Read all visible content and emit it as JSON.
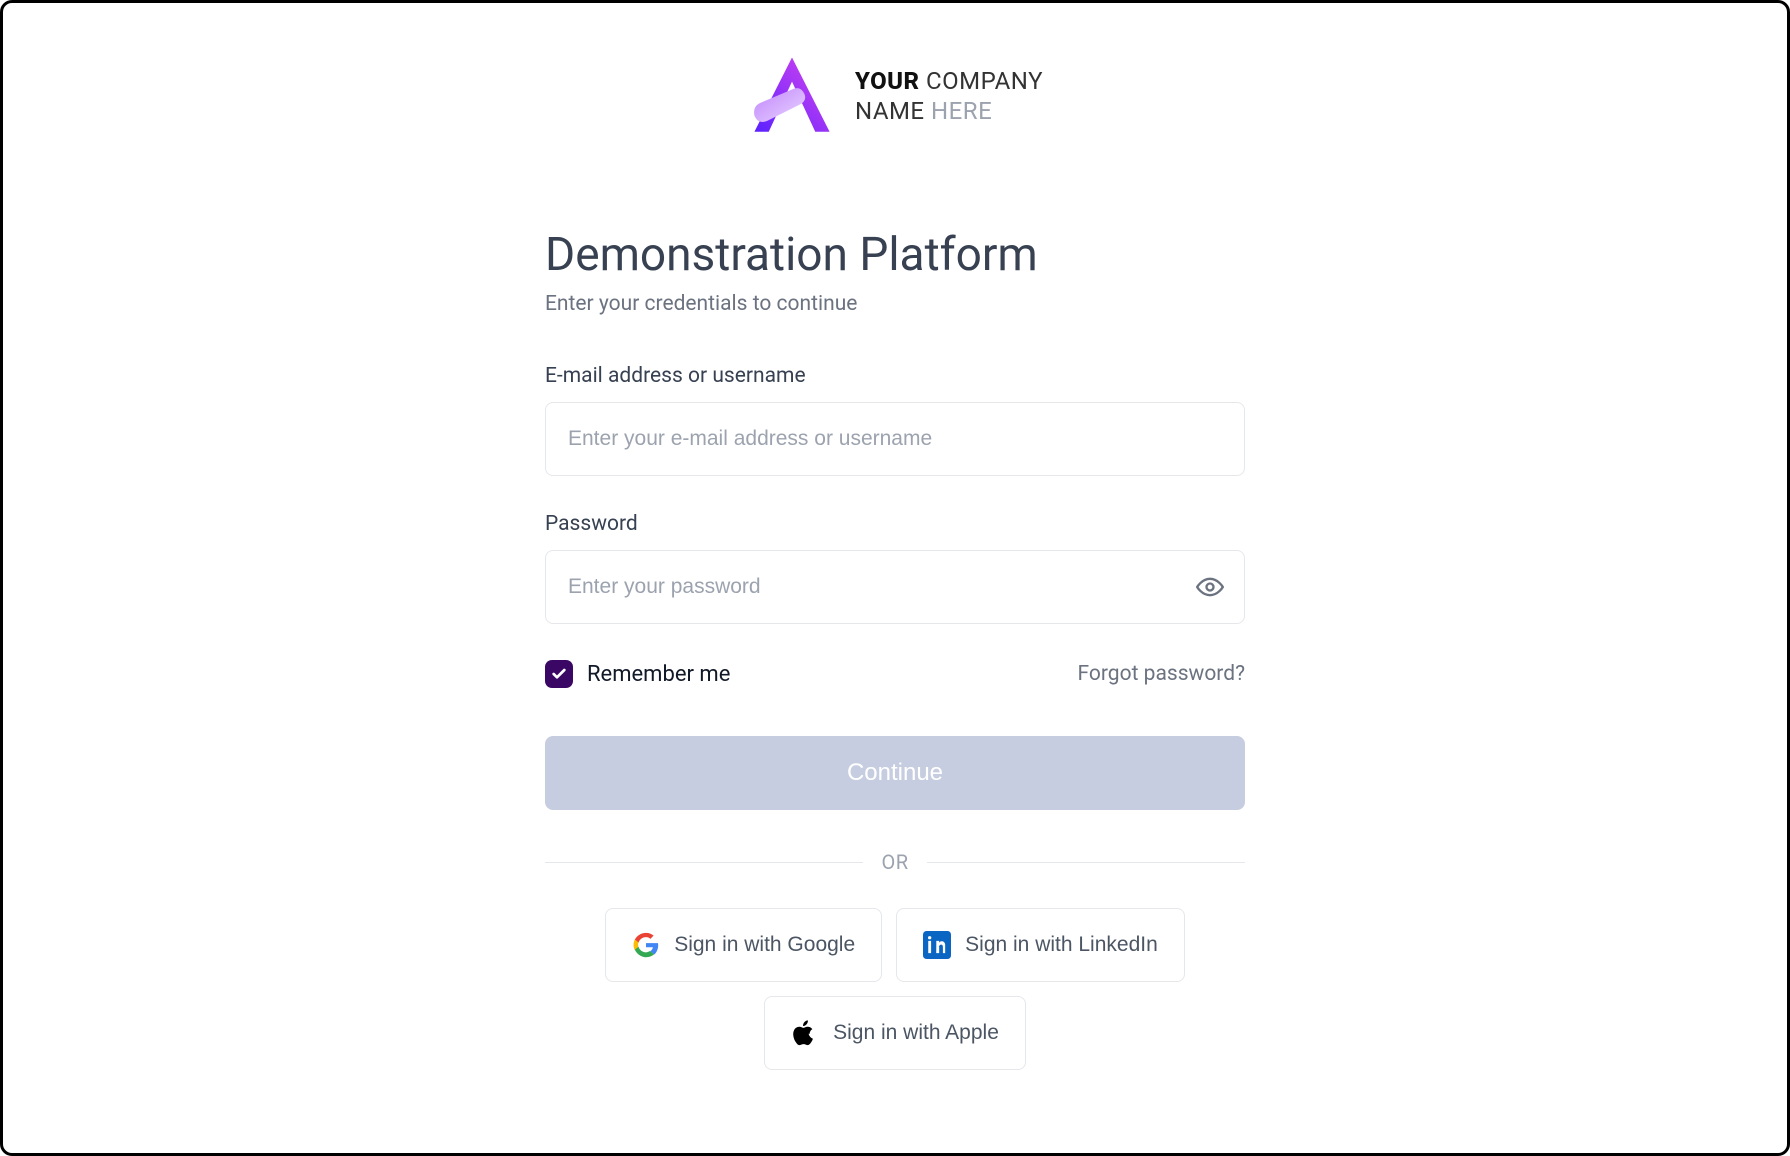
{
  "logo": {
    "line1_bold": "YOUR",
    "line1_light": " COMPANY",
    "line2_dark": "NAME",
    "line2_grey": " HERE"
  },
  "header": {
    "title": "Demonstration Platform",
    "subtitle": "Enter your credentials to continue"
  },
  "form": {
    "email_label": "E-mail address or username",
    "email_placeholder": "Enter your e-mail address or username",
    "password_label": "Password",
    "password_placeholder": "Enter your password",
    "remember_label": "Remember me",
    "remember_checked": true,
    "forgot_label": "Forgot password?",
    "continue_label": "Continue"
  },
  "divider": {
    "text": "OR"
  },
  "social": {
    "google": "Sign in with Google",
    "linkedin": "Sign in with LinkedIn",
    "apple": "Sign in with Apple"
  }
}
